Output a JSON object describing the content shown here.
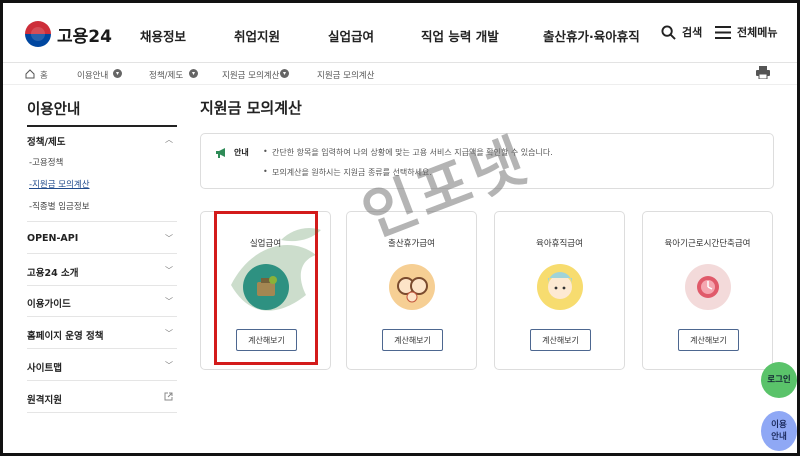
{
  "header": {
    "logo_text": "고용24",
    "nav": [
      "채용정보",
      "취업지원",
      "실업급여",
      "직업 능력 개발",
      "출산휴가·육아휴직"
    ],
    "search_label": "검색",
    "menu_label": "전체메뉴"
  },
  "breadcrumb": [
    "홈",
    "이용안내",
    "정책/제도",
    "지원금 모의계산",
    "지원금 모의계산"
  ],
  "sidebar": {
    "title": "이용안내",
    "groups": [
      {
        "label": "정책/제도",
        "sub": [
          "-고용정책",
          "-지원금 모의계산",
          "-직종별 임금정보"
        ]
      },
      {
        "label": "OPEN-API"
      },
      {
        "label": "고용24 소개"
      },
      {
        "label": "이용가이드"
      },
      {
        "label": "홈페이지 운영 정책"
      },
      {
        "label": "사이트맵"
      },
      {
        "label": "원격지원"
      }
    ]
  },
  "main": {
    "title": "지원금 모의계산",
    "notice": {
      "label": "안내",
      "lines": [
        "간단한 항목을 입력하여 나의 상황에 맞는 고용 서비스 지급액을 확인할 수 있습니다.",
        "모의계산을 원하시는 지원금 종류를 선택하세요."
      ]
    },
    "cards": [
      {
        "title": "실업급여",
        "button": "계산해보기",
        "icon": "unemployment-benefit-icon",
        "color": "#2b9a9a"
      },
      {
        "title": "출산휴가급여",
        "button": "계산해보기",
        "icon": "maternity-leave-icon",
        "color": "#f6cf94"
      },
      {
        "title": "육아휴직급여",
        "button": "계산해보기",
        "icon": "childcare-leave-icon",
        "color": "#f7dc6f"
      },
      {
        "title": "육아기근로시간단축급여",
        "button": "계산해보기",
        "icon": "reduced-hours-icon",
        "color": "#f3dada"
      }
    ]
  },
  "watermark": "인포넷",
  "floating": {
    "login": "로그인",
    "guide_line1": "이용",
    "guide_line2": "안내"
  }
}
